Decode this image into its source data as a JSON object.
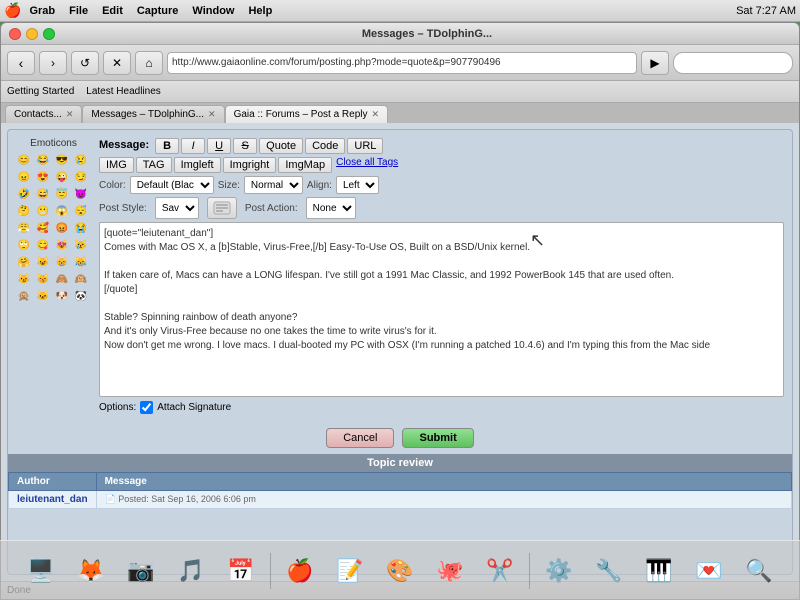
{
  "menubar": {
    "apple": "🍎",
    "items": [
      "Grab",
      "File",
      "Edit",
      "Capture",
      "Window",
      "Help"
    ],
    "right_info": "Sat 7:27 AM",
    "window_title": "Messages – TDolphinG..."
  },
  "window": {
    "title": "Gaia :: Forums – Post a Reply"
  },
  "toolbar": {
    "back_btn": "‹",
    "forward_btn": "›",
    "reload_btn": "↺",
    "stop_btn": "✕",
    "home_btn": "⌂",
    "address": "http://www.gaiaonline.com/forum/posting.php?mode=quote&p=907790496"
  },
  "bookmarks": {
    "items": [
      "Getting Started",
      "Latest Headlines"
    ]
  },
  "tabs": [
    {
      "label": "Contacts...",
      "active": false
    },
    {
      "label": "Messages – TDolphinG...",
      "active": false
    },
    {
      "label": "Gaia :: Forums – Post a Reply",
      "active": true
    }
  ],
  "page": {
    "title": "Gaia :: Forums – Post a Reply",
    "tab_label": "Gaia :: Forums – Post a Reply"
  },
  "editor": {
    "message_label": "Message:",
    "buttons": {
      "bold": "B",
      "italic": "I",
      "underline": "U",
      "strike": "S",
      "quote": "Quote",
      "code": "Code",
      "url": "URL",
      "img": "IMG",
      "tag": "TAG",
      "imgleft": "Imgleft",
      "imgright": "Imgright",
      "imgmap": "ImgMap",
      "close_all_tags": "Close all Tags"
    },
    "color_label": "Color:",
    "color_value": "Default (Blac▾",
    "size_label": "Size:",
    "size_value": "Normal▾",
    "align_label": "Align:",
    "align_value": "Left▾",
    "post_style_label": "Post Style:",
    "post_style_value": "Sav▾",
    "post_action_label": "Post Action:",
    "post_action_value": "None▾",
    "textarea_content": "[quote=\"leiutenant_dan\"]\nComes with Mac OS X, a [b]Stable, Virus-Free,[/b] Easy-To-Use OS, Built on a BSD/Unix kernel.\n\nIf taken care of, Macs can have a LONG lifespan. I've still got a 1991 Mac Classic, and 1992 PowerBook 145 that are used often.\n[/quote]\n\nStable? Spinning rainbow of death anyone?\nAnd it's only Virus-Free because no one takes the time to write virus's for it.\nNow don't get me wrong. I love macs. I dual-booted my PC with OSX (I'm running a patched 10.4.6) and I'm typing this from the Mac side",
    "options_label": "Options:",
    "attach_signature": "Attach Signature",
    "cancel_btn": "Cancel",
    "submit_btn": "Submit"
  },
  "emoticons": {
    "label": "Emoticons",
    "icons": [
      "😊",
      "😂",
      "😎",
      "😢",
      "😠",
      "😍",
      "😜",
      "😏",
      "🤣",
      "😅",
      "😇",
      "😈",
      "🤔",
      "😬",
      "😱",
      "😴",
      "😤",
      "🥰",
      "😡",
      "😭",
      "🙄",
      "😋",
      "😻",
      "😿",
      "🤗",
      "😺",
      "😸",
      "😹",
      "😼",
      "😽",
      "🙈",
      "🙉",
      "🙊",
      "🐱",
      "🐶",
      "🐼"
    ]
  },
  "topic_review": {
    "header": "Topic review",
    "col_author": "Author",
    "col_message": "Message",
    "rows": [
      {
        "author": "leiutenant_dan",
        "post_meta": "📄 Posted: Sat Sep 16, 2006 6:06 pm",
        "message": ""
      }
    ]
  },
  "status_bar": {
    "text": "Done"
  },
  "dock": {
    "items": [
      {
        "icon": "🖥️",
        "name": "finder"
      },
      {
        "icon": "🦊",
        "name": "firefox"
      },
      {
        "icon": "📷",
        "name": "camera"
      },
      {
        "icon": "🎵",
        "name": "music"
      },
      {
        "icon": "📅",
        "name": "calendar"
      },
      {
        "icon": "🍎",
        "name": "apple"
      },
      {
        "icon": "📝",
        "name": "notes"
      },
      {
        "icon": "🎨",
        "name": "art"
      },
      {
        "icon": "🐙",
        "name": "octopus"
      },
      {
        "icon": "✂️",
        "name": "scissors"
      },
      {
        "icon": "⚙️",
        "name": "settings"
      },
      {
        "icon": "🔧",
        "name": "tools"
      },
      {
        "icon": "🎹",
        "name": "piano"
      },
      {
        "icon": "💌",
        "name": "mail"
      },
      {
        "icon": "🔍",
        "name": "spotlight"
      }
    ]
  }
}
